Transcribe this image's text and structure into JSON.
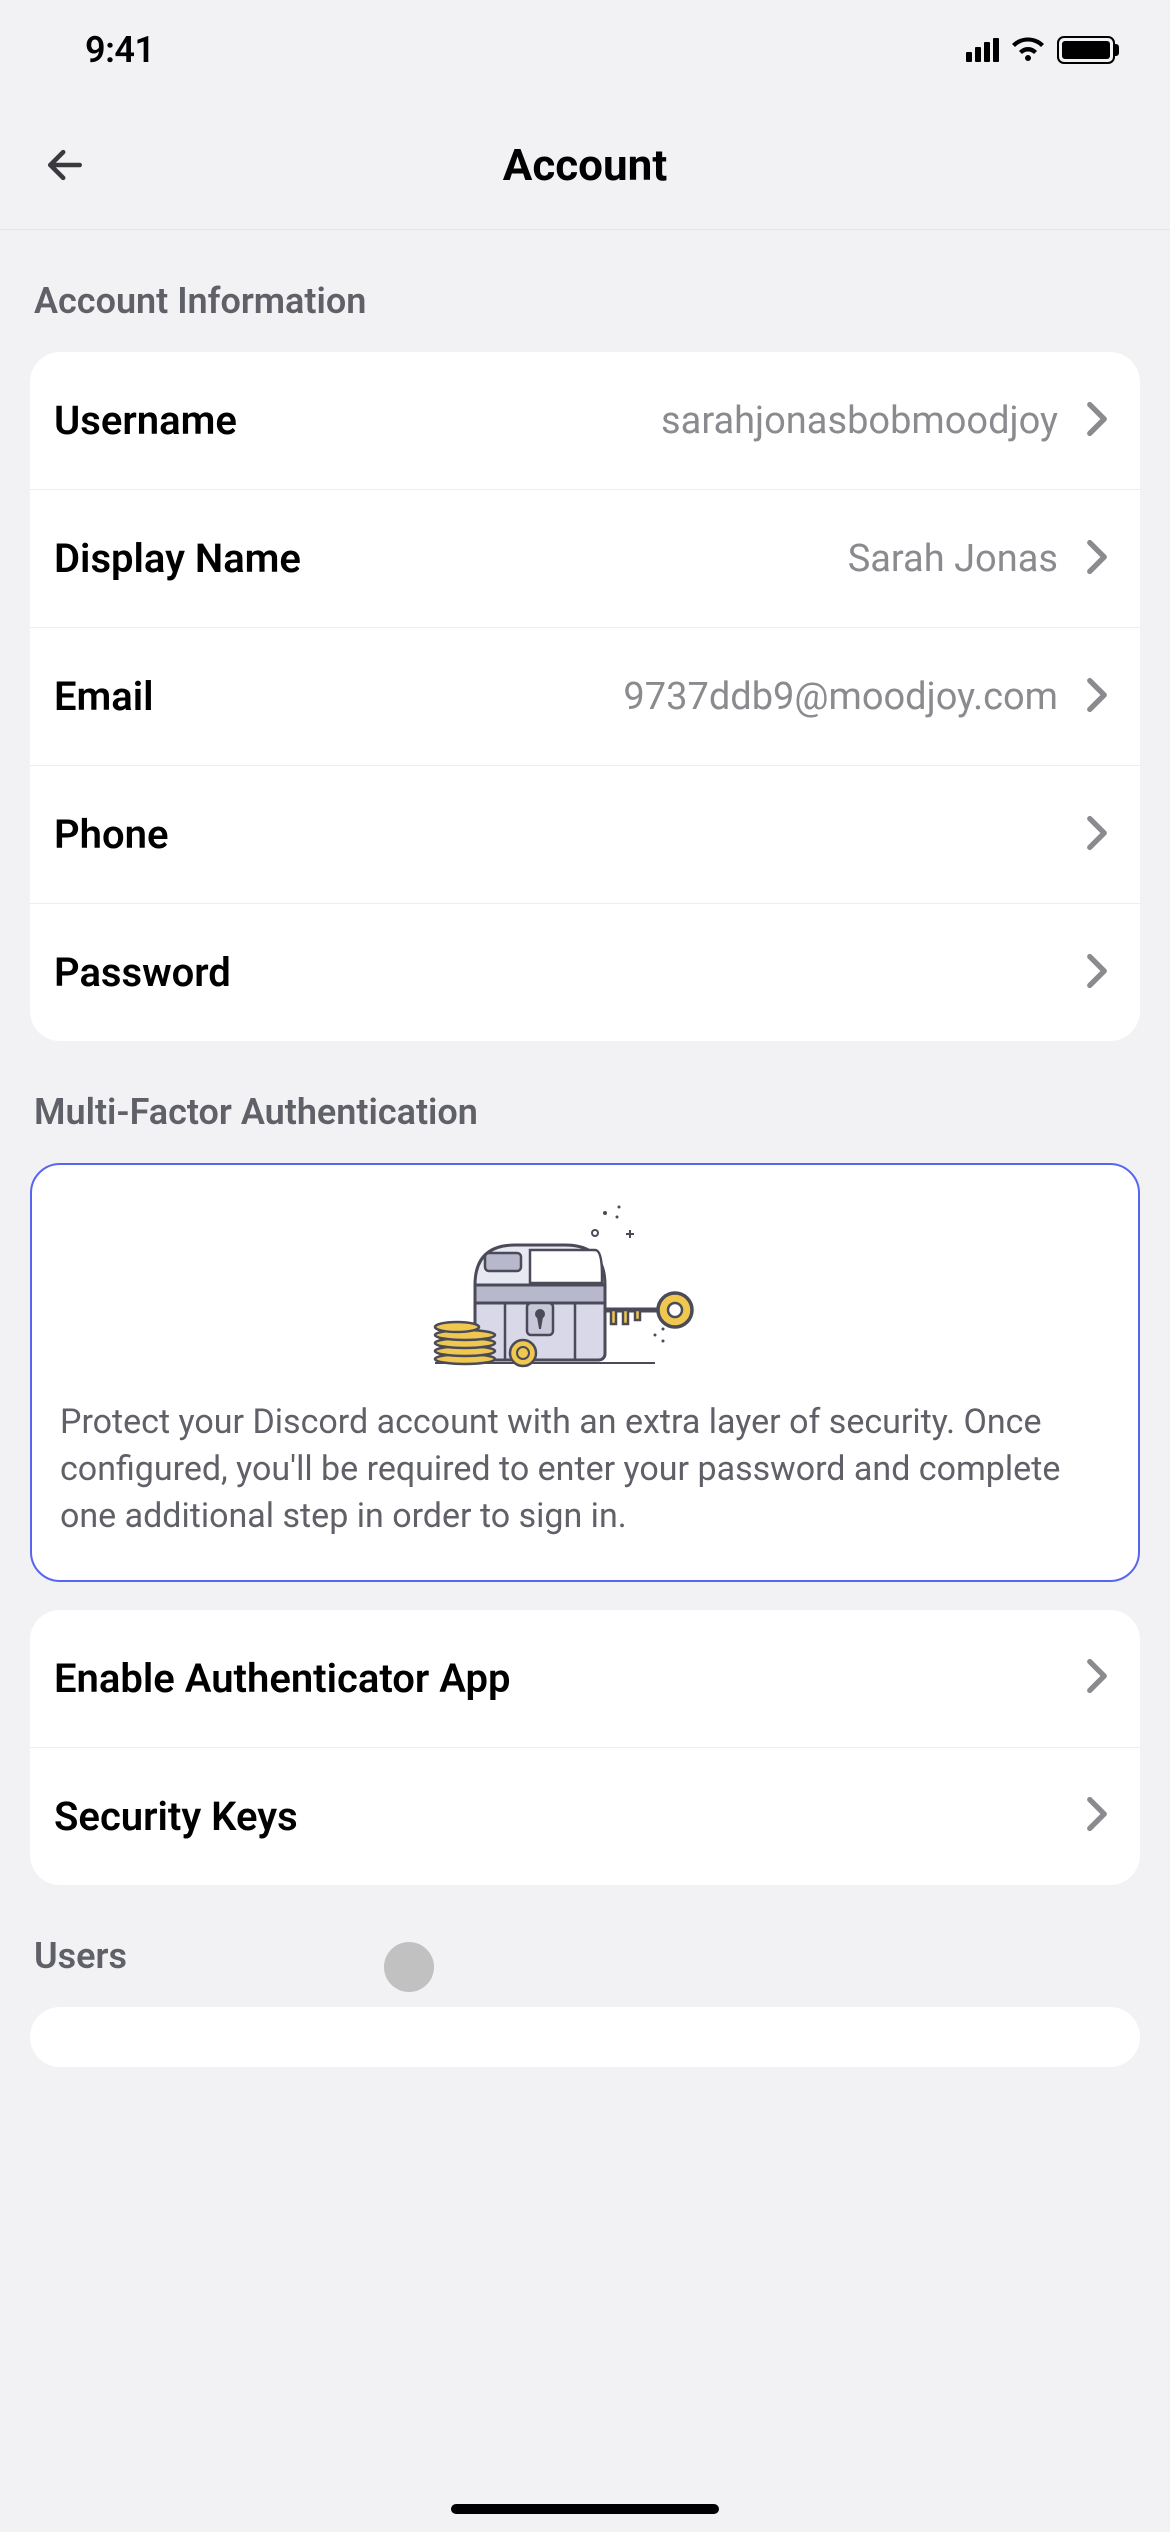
{
  "status": {
    "time": "9:41"
  },
  "header": {
    "title": "Account"
  },
  "sections": {
    "account_info": {
      "header": "Account Information",
      "rows": {
        "username": {
          "label": "Username",
          "value": "sarahjonasbobmoodjoy"
        },
        "display_name": {
          "label": "Display Name",
          "value": "Sarah Jonas"
        },
        "email": {
          "label": "Email",
          "value": "9737ddb9@moodjoy.com"
        },
        "phone": {
          "label": "Phone",
          "value": ""
        },
        "password": {
          "label": "Password",
          "value": ""
        }
      }
    },
    "mfa": {
      "header": "Multi-Factor Authentication",
      "description": "Protect your Discord account with an extra layer of security. Once configured, you'll be required to enter your password and complete one additional step in order to sign in.",
      "rows": {
        "authenticator": {
          "label": "Enable Authenticator App"
        },
        "security_keys": {
          "label": "Security Keys"
        }
      }
    },
    "users": {
      "header": "Users"
    }
  }
}
